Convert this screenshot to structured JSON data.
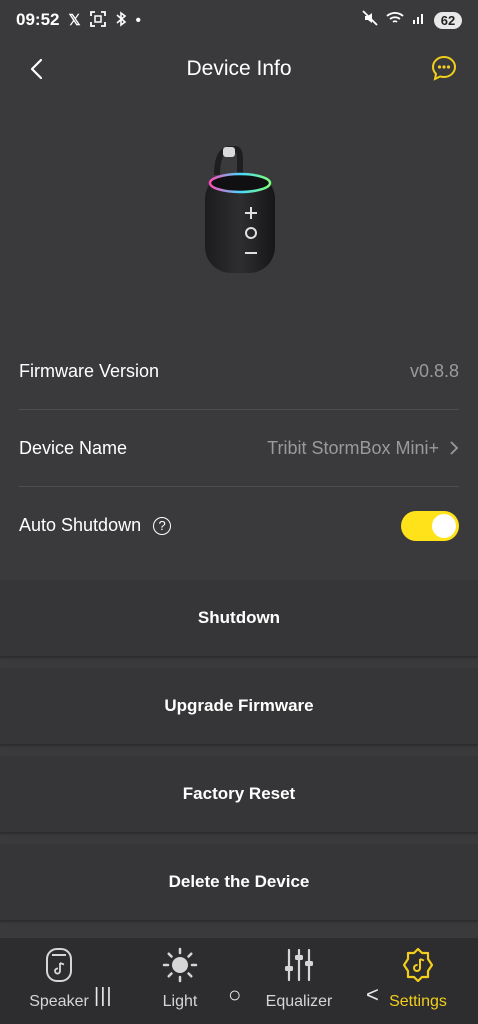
{
  "status_bar": {
    "time": "09:52",
    "battery": "62",
    "icons": [
      "x-logo-icon",
      "screenshot-icon",
      "bluetooth-icon",
      "dot-icon",
      "mute-icon",
      "wifi-icon",
      "signal-icon"
    ]
  },
  "header": {
    "title": "Device Info",
    "back_icon": "chevron-left-icon",
    "chat_icon": "chat-bubble-icon"
  },
  "device": {
    "image": "speaker-product-image"
  },
  "info": {
    "firmware_label": "Firmware Version",
    "firmware_value": "v0.8.8",
    "name_label": "Device Name",
    "name_value": "Tribit StormBox Mini+",
    "auto_shutdown_label": "Auto Shutdown",
    "help_glyph": "?",
    "auto_shutdown_on": true
  },
  "actions": {
    "shutdown": "Shutdown",
    "upgrade": "Upgrade Firmware",
    "reset": "Factory Reset",
    "delete": "Delete the Device"
  },
  "tabs": [
    {
      "label": "Speaker",
      "icon": "speaker-icon",
      "active": false
    },
    {
      "label": "Light",
      "icon": "light-icon",
      "active": false
    },
    {
      "label": "Equalizer",
      "icon": "equalizer-icon",
      "active": false
    },
    {
      "label": "Settings",
      "icon": "settings-icon",
      "active": true
    }
  ],
  "system_nav": {
    "recents": "|||",
    "home": "○",
    "back": "<"
  },
  "colors": {
    "background": "#3a3a3c",
    "accent": "#f3cf1b",
    "toggle_on": "#ffe21a"
  }
}
